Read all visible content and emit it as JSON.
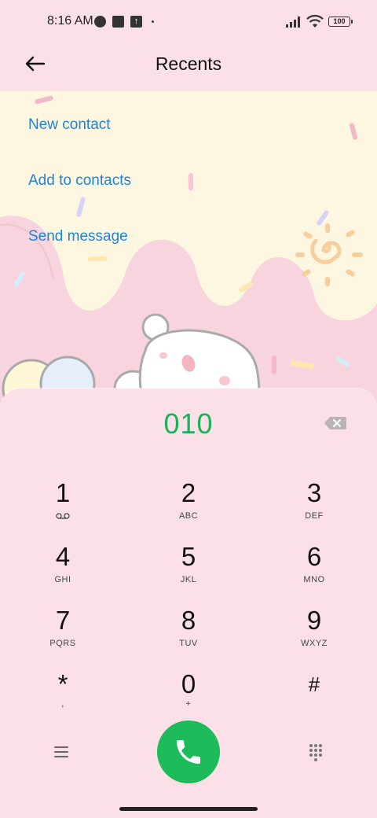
{
  "status_bar": {
    "time": "8:16 AM",
    "battery": "100"
  },
  "header": {
    "title": "Recents",
    "back_icon": "arrow-left-icon"
  },
  "actions": {
    "new_contact": "New contact",
    "add_to_contacts": "Add to contacts",
    "send_message": "Send message"
  },
  "dialer": {
    "number": "010",
    "keys": [
      {
        "digit": "1",
        "letters": ""
      },
      {
        "digit": "2",
        "letters": "ABC"
      },
      {
        "digit": "3",
        "letters": "DEF"
      },
      {
        "digit": "4",
        "letters": "GHI"
      },
      {
        "digit": "5",
        "letters": "JKL"
      },
      {
        "digit": "6",
        "letters": "MNO"
      },
      {
        "digit": "7",
        "letters": "PQRS"
      },
      {
        "digit": "8",
        "letters": "TUV"
      },
      {
        "digit": "9",
        "letters": "WXYZ"
      },
      {
        "digit": "*",
        "letters": ","
      },
      {
        "digit": "0",
        "letters": "+"
      },
      {
        "digit": "#",
        "letters": ""
      }
    ]
  },
  "colors": {
    "accent_link": "#1e84d8",
    "number_green": "#18b25a",
    "call_green": "#1dbb5a",
    "background": "#fbe1e7"
  }
}
